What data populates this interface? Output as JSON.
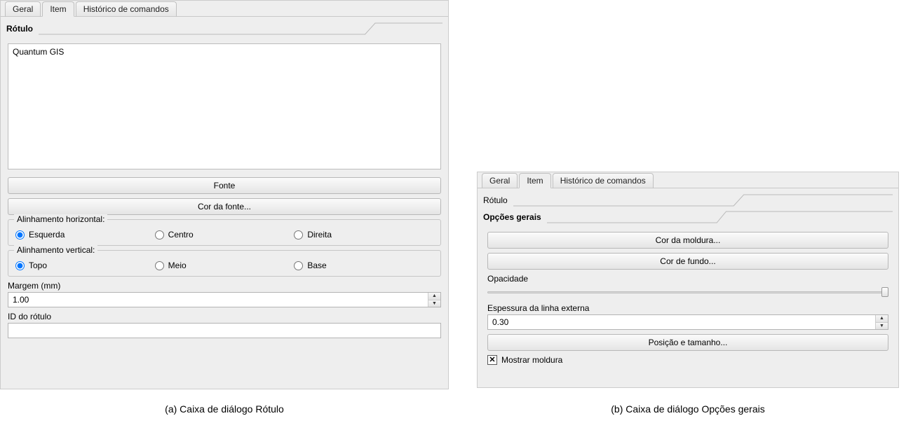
{
  "tabs": {
    "geral": "Geral",
    "item": "Item",
    "historico": "Histórico de comandos"
  },
  "left": {
    "section_title": "Rótulo",
    "textarea_value": "Quantum GIS",
    "btn_font": "Fonte",
    "btn_font_color": "Cor da fonte...",
    "group_halign": {
      "legend": "Alinhamento horizontal:",
      "opt_left": "Esquerda",
      "opt_center": "Centro",
      "opt_right": "Direita"
    },
    "group_valign": {
      "legend": "Alinhamento vertical:",
      "opt_top": "Topo",
      "opt_middle": "Meio",
      "opt_bottom": "Base"
    },
    "margin_label": "Margem (mm)",
    "margin_value": "1.00",
    "id_label": "ID do rótulo",
    "id_value": ""
  },
  "right": {
    "section_rotulo": "Rótulo",
    "section_opcoes": "Opções gerais",
    "btn_frame_color": "Cor da moldura...",
    "btn_bg_color": "Cor de fundo...",
    "opacity_label": "Opacidade",
    "outline_label": "Espessura da linha externa",
    "outline_value": "0.30",
    "btn_position": "Posição e tamanho...",
    "checkbox_frame": "Mostrar moldura",
    "checkbox_checked": true
  },
  "captions": {
    "a": "(a) Caixa de diálogo Rótulo",
    "b": "(b) Caixa de diálogo Opções gerais"
  }
}
